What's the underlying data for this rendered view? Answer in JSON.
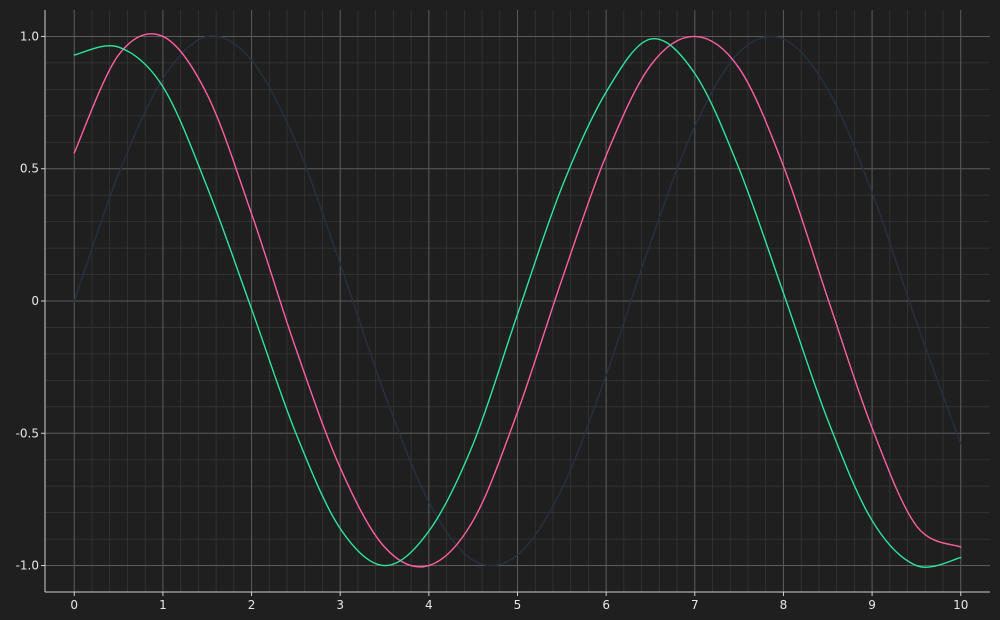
{
  "theme": {
    "background": "#1f1f1f",
    "axis_color": "#cfcfcf",
    "major_grid_color": "#5a5a5a",
    "minor_grid_color": "#353535",
    "tick_label_color": "#e6e6e6"
  },
  "chart_data": {
    "type": "line",
    "title": "",
    "xlabel": "",
    "ylabel": "",
    "xlim": [
      -0.33,
      10.33
    ],
    "ylim": [
      -1.1,
      1.1
    ],
    "grid": true,
    "minor_grid": true,
    "legend": "none",
    "x_ticks": [
      0,
      1,
      2,
      3,
      4,
      5,
      6,
      7,
      8,
      9,
      10
    ],
    "x_tick_labels": [
      "0",
      "1",
      "2",
      "3",
      "4",
      "5",
      "6",
      "7",
      "8",
      "9",
      "10"
    ],
    "y_ticks": [
      1.0,
      0.5,
      0,
      -0.5,
      -1.0
    ],
    "y_tick_labels": [
      "1.0",
      "0.5",
      "0",
      "-0.5",
      "-1.0"
    ],
    "x": [
      0,
      0.5,
      1,
      1.5,
      2,
      2.5,
      3,
      3.5,
      4,
      4.5,
      5,
      5.5,
      6,
      6.5,
      7,
      7.5,
      8,
      8.5,
      9,
      9.5,
      10
    ],
    "series": [
      {
        "color": "#263040",
        "y": [
          0.0,
          0.48,
          0.84,
          1.0,
          0.91,
          0.6,
          0.14,
          -0.35,
          -0.76,
          -0.98,
          -0.96,
          -0.71,
          -0.28,
          0.22,
          0.66,
          0.94,
          0.99,
          0.8,
          0.41,
          -0.08,
          -0.54
        ]
      },
      {
        "color": "#ff5fa2",
        "y": [
          0.56,
          0.93,
          1.0,
          0.78,
          0.33,
          -0.18,
          -0.63,
          -0.93,
          -1.0,
          -0.83,
          -0.42,
          0.08,
          0.55,
          0.89,
          1.0,
          0.88,
          0.51,
          0.01,
          -0.48,
          -0.85,
          -0.93
        ]
      },
      {
        "color": "#2ee6a0",
        "y": [
          0.93,
          0.96,
          0.81,
          0.43,
          -0.03,
          -0.5,
          -0.86,
          -1.0,
          -0.87,
          -0.54,
          -0.05,
          0.43,
          0.79,
          0.99,
          0.86,
          0.5,
          0.03,
          -0.45,
          -0.83,
          -1.0,
          -0.97
        ]
      }
    ]
  }
}
